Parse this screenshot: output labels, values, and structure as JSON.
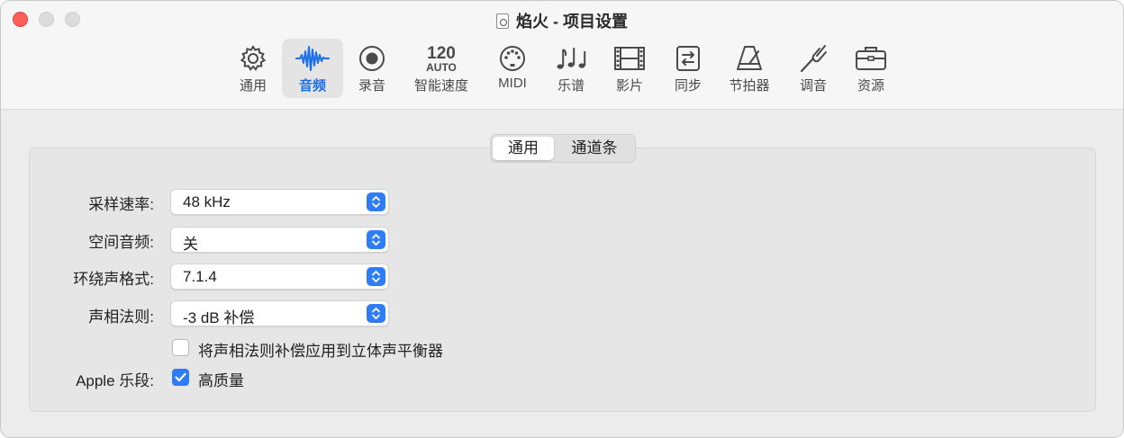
{
  "window": {
    "title": "焰火 - 项目设置"
  },
  "toolbar": {
    "tabs": [
      {
        "label": "通用",
        "icon": "gear-icon"
      },
      {
        "label": "音频",
        "icon": "waveform-icon",
        "selected": true
      },
      {
        "label": "录音",
        "icon": "record-icon"
      },
      {
        "label": "智能速度",
        "icon": "smart-tempo-icon",
        "icon_text_top": "120",
        "icon_text_bottom": "AUTO"
      },
      {
        "label": "MIDI",
        "icon": "midi-icon"
      },
      {
        "label": "乐谱",
        "icon": "score-icon"
      },
      {
        "label": "影片",
        "icon": "film-icon"
      },
      {
        "label": "同步",
        "icon": "sync-icon"
      },
      {
        "label": "节拍器",
        "icon": "metronome-icon"
      },
      {
        "label": "调音",
        "icon": "tuning-fork-icon"
      },
      {
        "label": "资源",
        "icon": "briefcase-icon"
      }
    ]
  },
  "segmented": {
    "general": "通用",
    "channel_strip": "通道条"
  },
  "settings": {
    "sample_rate": {
      "label": "采样速率:",
      "value": "48 kHz"
    },
    "spatial_audio": {
      "label": "空间音频:",
      "value": "关"
    },
    "surround_format": {
      "label": "环绕声格式:",
      "value": "7.1.4"
    },
    "pan_law": {
      "label": "声相法则:",
      "value": "-3 dB 补偿"
    },
    "stereo_balancer": {
      "label": "将声相法则补偿应用到立体声平衡器",
      "checked": false
    },
    "apple_loops": {
      "label": "Apple 乐段:",
      "option": "高质量",
      "checked": true
    }
  },
  "colors": {
    "accent": "#2e7df6",
    "close": "#ff5f57",
    "selected_tab_text": "#1c6fe6"
  }
}
